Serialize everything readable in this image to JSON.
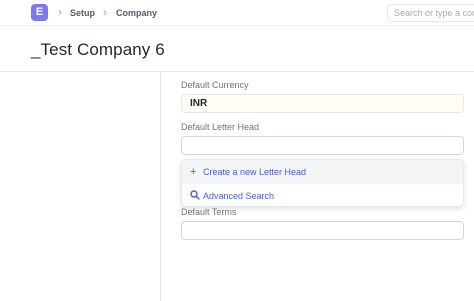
{
  "app": {
    "logo_letter": "E"
  },
  "breadcrumb": [
    {
      "label": "Setup"
    },
    {
      "label": "Company"
    }
  ],
  "search": {
    "placeholder": "Search or type a command"
  },
  "page": {
    "title": "_Test Company 6"
  },
  "form": {
    "default_currency": {
      "label": "Default Currency",
      "value": "INR"
    },
    "default_letter_head": {
      "label": "Default Letter Head",
      "value": ""
    },
    "default_terms": {
      "label": "Default Terms",
      "value": ""
    }
  },
  "dropdown": {
    "items": [
      {
        "label": "Create a new Letter Head",
        "icon": "plus-icon",
        "highlighted": true
      },
      {
        "label": "Advanced Search",
        "icon": "search-icon",
        "highlighted": false
      }
    ]
  },
  "colors": {
    "accent": "#4b5bd6",
    "logo": "#7d78ee",
    "currency_field_bg": "#fffdf4"
  }
}
